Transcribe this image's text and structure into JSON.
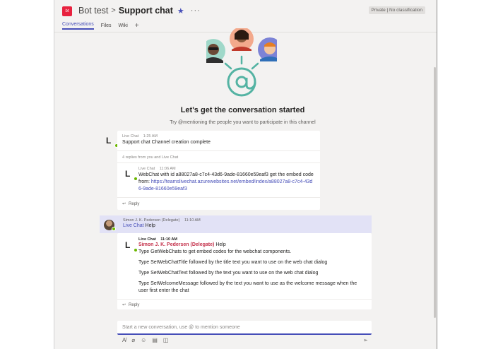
{
  "header": {
    "team_avatar": "bt",
    "team_name": "Bot test",
    "separator": ">",
    "channel_name": "Support chat",
    "star_icon": "star-icon",
    "more": "···",
    "privacy": "Private | No classification"
  },
  "tabs": [
    {
      "label": "Conversations",
      "active": true
    },
    {
      "label": "Files",
      "active": false
    },
    {
      "label": "Wiki",
      "active": false
    },
    {
      "label": "+",
      "active": false
    }
  ],
  "hero": {
    "title": "Let's get the conversation started",
    "subtitle": "Try @mentioning the people you want to participate in this channel"
  },
  "thread1": {
    "author": "Live Chat",
    "time": "1:25 AM",
    "text": "Support chat Channel creation complete",
    "replies_summary": "4 replies from you and Live Chat",
    "reply": {
      "author": "Live Chat",
      "time": "11:06 AM",
      "text_before": "WebChat with id a88027a8-c7c4-43d6-9ade-81660e59eaf3 get the embed code from: ",
      "link": "https://teamslivechat.azurewebsites.net/embed/index/a88027a8-c7c4-43d6-9ade-81660e59eaf3"
    },
    "reply_label": "Reply"
  },
  "thread2": {
    "author": "Simon J. K. Pedersen (Delegate)",
    "time": "11:10 AM",
    "mention": "Live Chat",
    "text": "Help",
    "reply": {
      "author": "Live Chat",
      "time": "11:10 AM",
      "mention": "Simon J. K. Pedersen (Delegate)",
      "mention_text": "Help",
      "lines": [
        "Type GetWebChats to get embed codes for the webchat components.",
        "Type SetWebChatTitle followed by the title text you want to use on the web chat dialog",
        "Type SetWebChatText followed by the text you want to use on the web chat dialog",
        "Type SetWelcomeMessage followed by the text you want to use as the welcome message when the user first enter the chat"
      ]
    },
    "reply_label": "Reply"
  },
  "compose": {
    "placeholder": "Start a new conversation, use @ to mention someone"
  },
  "toolbar_icons": [
    "format-icon",
    "attach-icon",
    "emoji-icon",
    "giphy-icon",
    "meet-icon"
  ],
  "colors": {
    "accent": "#464eb8",
    "team": "#e8213e",
    "presence": "#6bb700",
    "mention": "#c4314b"
  }
}
